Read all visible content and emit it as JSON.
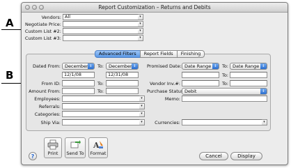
{
  "callouts": {
    "a": "A",
    "b": "B"
  },
  "window": {
    "title": "Report Customization – Returns and Debits"
  },
  "top_fields": {
    "vendors_label": "Vendors:",
    "vendors_value": "All",
    "negotiate_label": "Negotiate Price:",
    "negotiate_value": "",
    "custom2_label": "Custom List #2:",
    "custom2_value": "",
    "custom3_label": "Custom List #3:",
    "custom3_value": ""
  },
  "tabs": {
    "advanced": "Advanced Filters",
    "report": "Report Fields",
    "finishing": "Finishing"
  },
  "filters": {
    "dated_from_label": "Dated From:",
    "dated_from_popup": "December",
    "dated_to_label": "To:",
    "dated_to_popup": "December",
    "dated_from_value": "12/1/08",
    "dated_to_value": "12/31/08",
    "from_id_label": "From ID:",
    "from_id_value": "",
    "from_id_to_label": "To:",
    "from_id_to_value": "",
    "amount_label": "Amount From:",
    "amount_value": "",
    "amount_to_label": "To:",
    "amount_to_value": "",
    "employees_label": "Employees:",
    "employees_value": "",
    "referrals_label": "Referrals:",
    "referrals_value": "",
    "categories_label": "Categories:",
    "categories_value": "",
    "shipvia_label": "Ship Via:",
    "shipvia_value": "",
    "promised_label": "Promised Date:",
    "promised_popup": "Date Range",
    "promised_to_label": "To:",
    "promised_to_popup": "Date Range",
    "promised_from_value": "",
    "promised_to_label2": "To:",
    "promised_to_value": "",
    "vendor_inv_label": "Vendor Inv.#:",
    "vendor_inv_value": "",
    "vendor_inv_to_label": "To:",
    "vendor_inv_to_value": "",
    "purchase_status_label": "Purchase Status:",
    "purchase_status_value": "Debit",
    "memo_label": "Memo:",
    "memo_value": "",
    "currencies_label": "Currencies:",
    "currencies_value": ""
  },
  "buttons": {
    "print": "Print",
    "send_to": "Send To",
    "format": "Format",
    "cancel": "Cancel",
    "display": "Display",
    "help": "?"
  }
}
